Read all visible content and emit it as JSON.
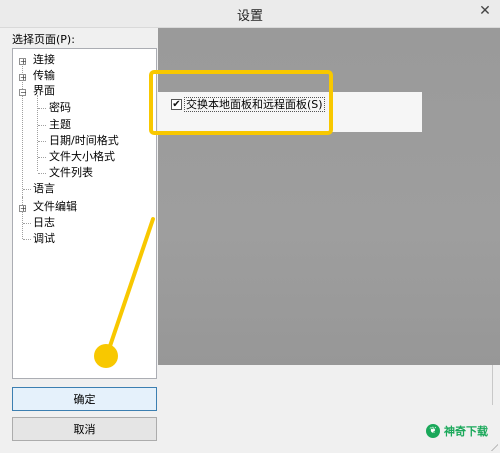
{
  "window": {
    "title": "设置",
    "close_glyph": "✕"
  },
  "sidebar": {
    "label": "选择页面(P):",
    "tree": [
      {
        "label": "连接",
        "level": 0,
        "expander": "+"
      },
      {
        "label": "传输",
        "level": 0,
        "expander": "+"
      },
      {
        "label": "界面",
        "level": 0,
        "expander": "−"
      },
      {
        "label": "密码",
        "level": 1
      },
      {
        "label": "主题",
        "level": 1
      },
      {
        "label": "日期/时间格式",
        "level": 1
      },
      {
        "label": "文件大小格式",
        "level": 1
      },
      {
        "label": "文件列表",
        "level": 1
      },
      {
        "label": "语言",
        "level": 0
      },
      {
        "label": "文件编辑",
        "level": 0,
        "expander": "+"
      },
      {
        "label": "日志",
        "level": 0
      },
      {
        "label": "调试",
        "level": 0
      }
    ]
  },
  "buttons": {
    "ok": "确定",
    "cancel": "取消"
  },
  "content": {
    "checkbox": {
      "label": "交换本地面板和远程面板(S)",
      "checked": true,
      "mark": "✔"
    }
  },
  "watermark": {
    "text": "神奇下载"
  },
  "colors": {
    "highlight": "#f8c800",
    "watermark": "#1aa85a"
  }
}
